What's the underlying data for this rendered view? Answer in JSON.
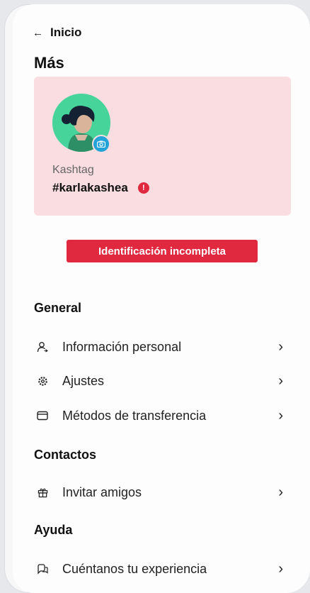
{
  "nav": {
    "back_label": "Inicio"
  },
  "page": {
    "title": "Más"
  },
  "profile": {
    "kashtag_label": "Kashtag",
    "kashtag_value": "#karlakashea",
    "alert_symbol": "!"
  },
  "status_badge": {
    "label": "Identificación incompleta",
    "color": "#e0293f"
  },
  "sections": {
    "general": {
      "title": "General",
      "items": [
        {
          "label": "Información personal",
          "icon": "person-icon"
        },
        {
          "label": "Ajustes",
          "icon": "gear-icon"
        },
        {
          "label": "Métodos de transferencia",
          "icon": "wallet-icon"
        }
      ]
    },
    "contacts": {
      "title": "Contactos",
      "items": [
        {
          "label": "Invitar amigos",
          "icon": "gift-icon"
        }
      ]
    },
    "help": {
      "title": "Ayuda",
      "items": [
        {
          "label": "Cuéntanos tu experiencia",
          "icon": "feedback-icon"
        }
      ]
    }
  },
  "colors": {
    "card_background": "#f9dde0",
    "avatar_background": "#46d49b",
    "camera_badge": "#23a3d8",
    "alert": "#e0293f"
  }
}
